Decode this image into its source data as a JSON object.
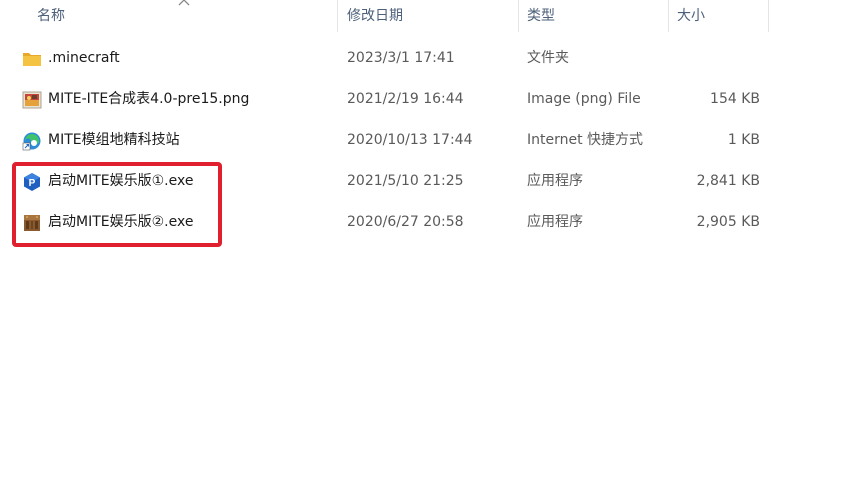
{
  "columns": {
    "name": "名称",
    "date": "修改日期",
    "type": "类型",
    "size": "大小"
  },
  "files": [
    {
      "name": ".minecraft",
      "date": "2023/3/1 17:41",
      "type": "文件夹",
      "size": "",
      "icon": "folder-icon"
    },
    {
      "name": "MITE-ITE合成表4.0-pre15.png",
      "date": "2021/2/19 16:44",
      "type": "Image (png) File",
      "size": "154 KB",
      "icon": "png-image-icon"
    },
    {
      "name": "MITE模组地精科技站",
      "date": "2020/10/13 17:44",
      "type": "Internet 快捷方式",
      "size": "1 KB",
      "icon": "edge-shortcut-icon"
    },
    {
      "name": "启动MITE娱乐版①.exe",
      "date": "2021/5/10 21:25",
      "type": "应用程序",
      "size": "2,841 KB",
      "icon": "launcher-p-icon"
    },
    {
      "name": "启动MITE娱乐版②.exe",
      "date": "2020/6/27 20:58",
      "type": "应用程序",
      "size": "2,905 KB",
      "icon": "crafting-table-icon"
    }
  ],
  "colors": {
    "highlight": "#e0202e",
    "folder": "#f5c342",
    "header_text": "#4c607a"
  }
}
